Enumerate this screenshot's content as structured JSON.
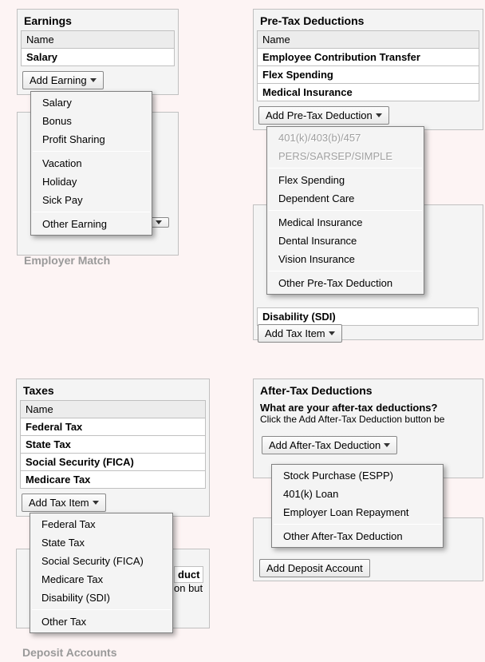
{
  "earnings": {
    "title": "Earnings",
    "name_header": "Name",
    "items": [
      "Salary"
    ],
    "add_label": "Add Earning",
    "menu": {
      "group1": [
        "Salary",
        "Bonus",
        "Profit Sharing"
      ],
      "group2": [
        "Vacation",
        "Holiday",
        "Sick Pay"
      ],
      "other": "Other Earning"
    },
    "behind_label": "Employer Match"
  },
  "pretax": {
    "title": "Pre-Tax Deductions",
    "name_header": "Name",
    "items": [
      "Employee Contribution Transfer",
      "Flex Spending",
      "Medical Insurance"
    ],
    "add_label": "Add Pre-Tax Deduction",
    "menu": {
      "disabled": [
        "401(k)/403(b)/457",
        "PERS/SARSEP/SIMPLE"
      ],
      "group1": [
        "Flex Spending",
        "Dependent Care"
      ],
      "group2": [
        "Medical Insurance",
        "Dental Insurance",
        "Vision Insurance"
      ],
      "other": "Other Pre-Tax Deduction"
    },
    "behind_row": "Disability (SDI)",
    "second_add": "Add Tax Item"
  },
  "taxes": {
    "title": "Taxes",
    "name_header": "Name",
    "items": [
      "Federal Tax",
      "State Tax",
      "Social Security (FICA)",
      "Medicare Tax"
    ],
    "add_label": "Add Tax Item",
    "menu": {
      "group1": [
        "Federal Tax",
        "State Tax",
        "Social Security (FICA)",
        "Medicare Tax",
        "Disability (SDI)"
      ],
      "other": "Other Tax"
    },
    "behind_frag1": "duct",
    "behind_frag2": "on but",
    "behind_label": "Deposit Accounts"
  },
  "aftertax": {
    "title": "After-Tax Deductions",
    "question": "What are your after-tax deductions?",
    "hint": "Click the Add After-Tax Deduction button be",
    "add_label": "Add After-Tax Deduction",
    "menu": {
      "group1": [
        "Stock Purchase (ESPP)",
        "401(k) Loan",
        "Employer Loan Repayment"
      ],
      "other": "Other After-Tax Deduction"
    },
    "behind_btn": "Add Deposit Account"
  }
}
